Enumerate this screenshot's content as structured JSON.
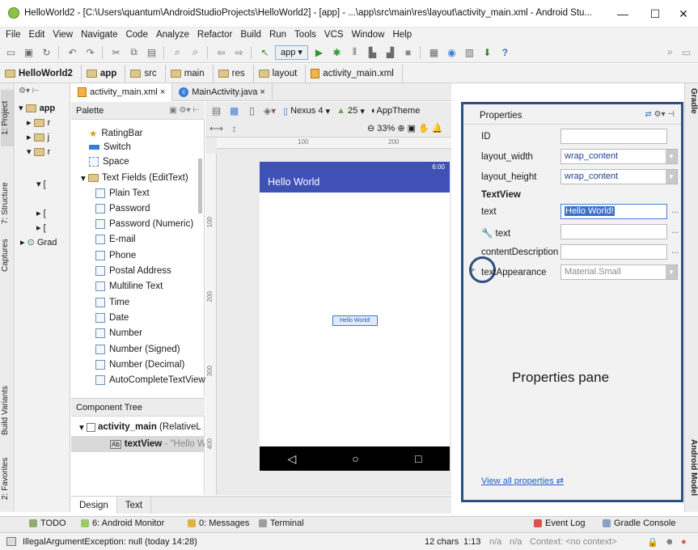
{
  "window": {
    "title": "HelloWorld2 - [C:\\Users\\quantum\\AndroidStudioProjects\\HelloWorld2] - [app] - ...\\app\\src\\main\\res\\layout\\activity_main.xml - Android Stu...",
    "minimize": "—",
    "maximize": "☐",
    "close": "✕"
  },
  "menu": [
    "File",
    "Edit",
    "View",
    "Navigate",
    "Code",
    "Analyze",
    "Refactor",
    "Build",
    "Run",
    "Tools",
    "VCS",
    "Window",
    "Help"
  ],
  "toolbar": {
    "run_config": "app",
    "help": "?"
  },
  "breadcrumb": [
    "HelloWorld2",
    "app",
    "src",
    "main",
    "res",
    "layout",
    "activity_main.xml"
  ],
  "left_tabs": [
    "1: Project",
    "7: Structure",
    "Captures",
    "Build Variants",
    "2: Favorites"
  ],
  "right_tabs": [
    "Gradle",
    "Android Model"
  ],
  "project_tree": {
    "root": "app",
    "items": [
      "r",
      "j",
      "r",
      "[",
      "[",
      "[",
      "Grad"
    ]
  },
  "editor_tabs": [
    {
      "label": "activity_main.xml",
      "close": "×"
    },
    {
      "label": "MainActivity.java",
      "close": "×"
    }
  ],
  "palette": {
    "title": "Palette",
    "items": [
      {
        "label": "RatingBar",
        "kind": "widget"
      },
      {
        "label": "Switch",
        "kind": "widget"
      },
      {
        "label": "Space",
        "kind": "widget"
      },
      {
        "label": "Text Fields (EditText)",
        "kind": "category"
      },
      {
        "label": "Plain Text",
        "kind": "field"
      },
      {
        "label": "Password",
        "kind": "field"
      },
      {
        "label": "Password (Numeric)",
        "kind": "field"
      },
      {
        "label": "E-mail",
        "kind": "field"
      },
      {
        "label": "Phone",
        "kind": "field"
      },
      {
        "label": "Postal Address",
        "kind": "field"
      },
      {
        "label": "Multiline Text",
        "kind": "field"
      },
      {
        "label": "Time",
        "kind": "field"
      },
      {
        "label": "Date",
        "kind": "field"
      },
      {
        "label": "Number",
        "kind": "field"
      },
      {
        "label": "Number (Signed)",
        "kind": "field"
      },
      {
        "label": "Number (Decimal)",
        "kind": "field"
      },
      {
        "label": "AutoCompleteTextView",
        "kind": "field"
      }
    ]
  },
  "component_tree": {
    "title": "Component Tree",
    "root": "activity_main",
    "root_suffix": "(RelativeL",
    "child": "textView",
    "child_suffix": "- \"Hello W"
  },
  "canvas_toolbar": {
    "device": "Nexus 4",
    "api": "25",
    "theme": "AppTheme",
    "zoom": "33%"
  },
  "rulers": {
    "h1": "100",
    "h2": "200",
    "v1": "100",
    "v2": "200",
    "v3": "300",
    "v4": "400"
  },
  "device_preview": {
    "time": "6:00",
    "app_title": "Hello World",
    "text_view": "Hello World!"
  },
  "nav_icons": {
    "back": "◁",
    "home": "○",
    "recent": "□"
  },
  "design_tabs": [
    "Design",
    "Text"
  ],
  "properties": {
    "title": "Properties",
    "rows": [
      {
        "label": "ID",
        "value": ""
      },
      {
        "label": "layout_width",
        "value": "wrap_content"
      },
      {
        "label": "layout_height",
        "value": "wrap_content"
      }
    ],
    "section": "TextView",
    "text_label": "text",
    "text_value": "Hello World!",
    "tools_text_label": "text",
    "content_description_label": "contentDescription",
    "text_appearance_label": "textAppearance",
    "text_appearance_value": "Material.Small",
    "pane_caption": "Properties pane",
    "view_all": "View all properties",
    "ellipsis": "..."
  },
  "bottom_tools": [
    "TODO",
    "6: Android Monitor",
    "0: Messages",
    "Terminal",
    "Event Log",
    "Gradle Console"
  ],
  "status": {
    "message": "IllegalArgumentException: null (today 14:28)",
    "chars": "12 chars",
    "position": "1:13",
    "na1": "n/a",
    "na2": "n/a",
    "context": "Context: <no context>"
  },
  "colors": {
    "accent": "#3f51b5",
    "highlight_frame": "#2f4f80",
    "link": "#1f5fc9"
  }
}
